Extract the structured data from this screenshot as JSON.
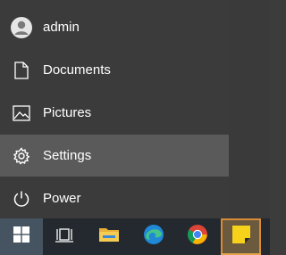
{
  "start_menu": {
    "items": [
      {
        "label": "admin",
        "icon": "user-avatar-icon"
      },
      {
        "label": "Documents",
        "icon": "document-icon"
      },
      {
        "label": "Pictures",
        "icon": "pictures-icon"
      },
      {
        "label": "Settings",
        "icon": "gear-icon",
        "highlighted": true
      },
      {
        "label": "Power",
        "icon": "power-icon"
      }
    ]
  },
  "taskbar": {
    "buttons": [
      {
        "name": "start",
        "icon": "windows-logo-icon"
      },
      {
        "name": "task-view",
        "icon": "task-view-icon"
      },
      {
        "name": "file-explorer",
        "icon": "folder-icon"
      },
      {
        "name": "edge",
        "icon": "edge-icon"
      },
      {
        "name": "chrome",
        "icon": "chrome-icon"
      },
      {
        "name": "sticky-notes",
        "icon": "sticky-notes-icon",
        "active": true
      }
    ],
    "colors": {
      "background": "#23292f",
      "start_bg": "#465361",
      "active_bg": "#6b5a3e",
      "active_border": "#d98c37",
      "notes_yellow": "#f6d21b"
    }
  },
  "colors": {
    "menu_bg": "#3b3b3b",
    "highlight_bg": "#5a5a5a",
    "text": "#ffffff"
  }
}
